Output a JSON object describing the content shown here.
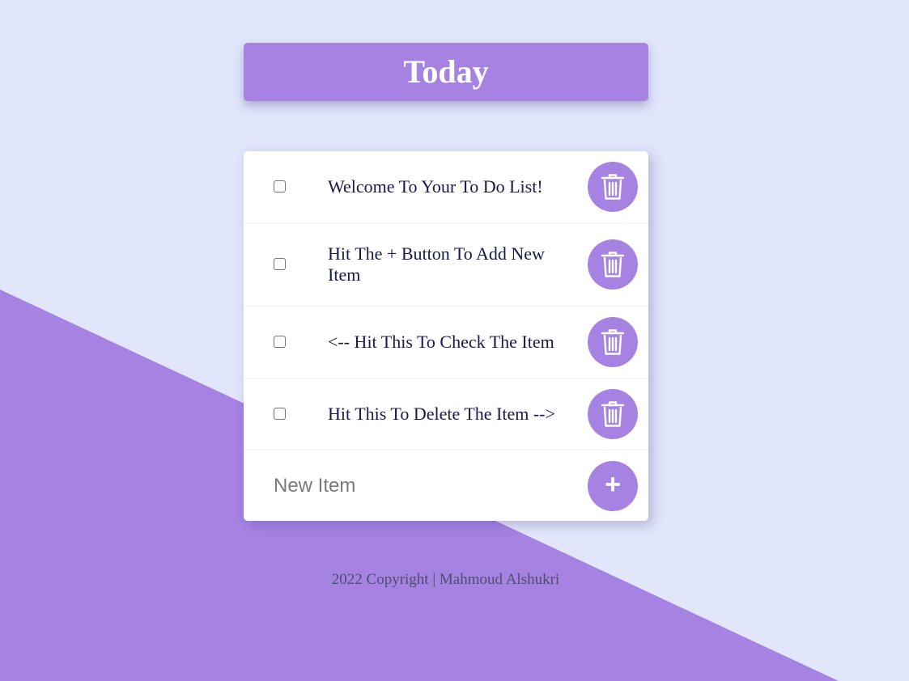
{
  "header": {
    "title": "Today"
  },
  "items": [
    {
      "label": "Welcome To Your To Do List!",
      "checked": false,
      "delete_icon": "trash-icon"
    },
    {
      "label": "Hit The + Button To Add New Item",
      "checked": false,
      "delete_icon": "trash-icon"
    },
    {
      "label": "<-- Hit This To Check The Item",
      "checked": false,
      "delete_icon": "trash-icon"
    },
    {
      "label": "Hit This To Delete The Item -->",
      "checked": false,
      "delete_icon": "trash-icon"
    }
  ],
  "new_item": {
    "placeholder": "New Item",
    "value": "",
    "add_glyph": "+",
    "add_icon": "plus-icon"
  },
  "footer": {
    "text": "2022 Copyright | Mahmoud Alshukri"
  },
  "colors": {
    "background": "#E1E6FB",
    "accent": "#A683E3",
    "text": "#16194A"
  }
}
